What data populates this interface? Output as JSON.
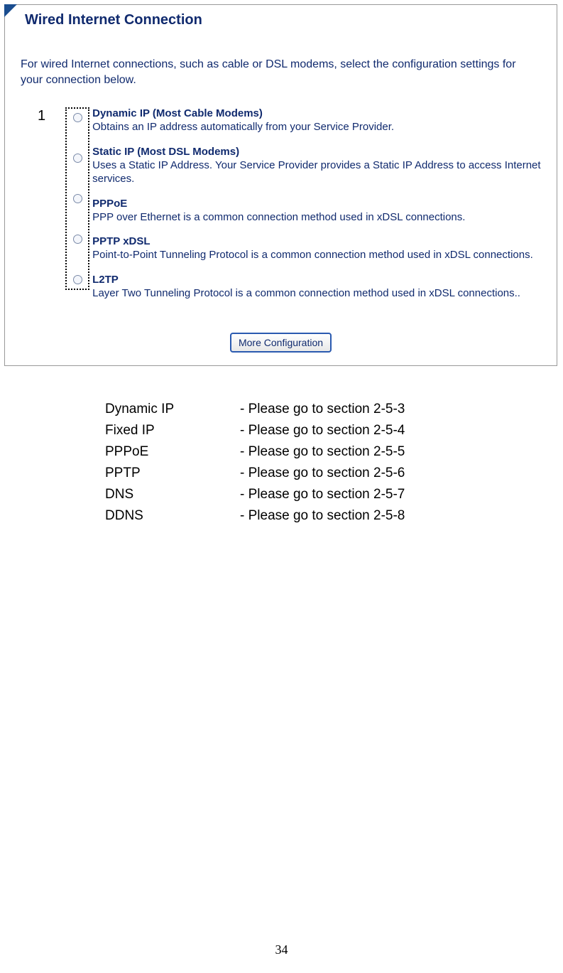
{
  "panel": {
    "title": "Wired Internet Connection",
    "intro": "For wired Internet connections, such as cable or DSL modems, select the configuration settings for your connection below.",
    "callout": "1",
    "options": [
      {
        "title": "Dynamic IP (Most Cable Modems)",
        "desc": "Obtains an IP address automatically from your Service Provider."
      },
      {
        "title": "Static IP (Most DSL Modems)",
        "desc": "Uses a Static IP Address. Your Service Provider provides a Static IP Address to access Internet services."
      },
      {
        "title": "PPPoE",
        "desc": "PPP over Ethernet is a common connection method used in xDSL connections."
      },
      {
        "title": "PPTP xDSL",
        "desc": "Point-to-Point Tunneling Protocol is a common connection method used in xDSL connections."
      },
      {
        "title": "L2TP",
        "desc": "Layer Two Tunneling Protocol is a common connection method used in xDSL connections.."
      }
    ],
    "button": "More Configuration"
  },
  "sections": [
    {
      "name": "Dynamic IP",
      "ref": "- Please go to section 2-5-3"
    },
    {
      "name": "Fixed IP",
      "ref": "- Please go to section 2-5-4"
    },
    {
      "name": "PPPoE",
      "ref": "- Please go to section 2-5-5"
    },
    {
      "name": "PPTP",
      "ref": "- Please go to section 2-5-6"
    },
    {
      "name": "DNS",
      "ref": "- Please go to section 2-5-7"
    },
    {
      "name": "DDNS",
      "ref": "- Please go to section 2-5-8"
    }
  ],
  "page_number": "34"
}
